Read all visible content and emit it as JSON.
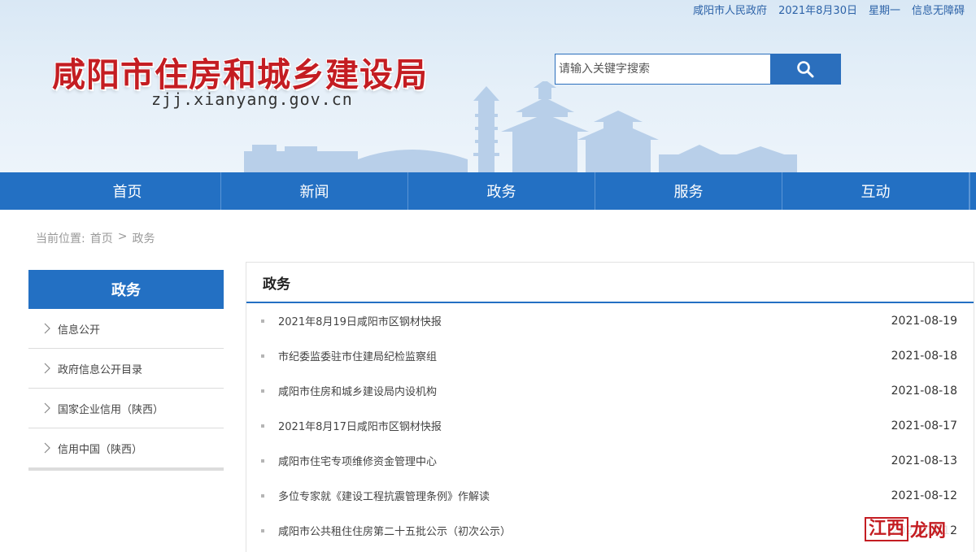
{
  "topbar": {
    "gov_link": "咸阳市人民政府",
    "date": "2021年8月30日",
    "weekday": "星期一",
    "accessibility": "信息无障碍"
  },
  "site": {
    "title": "咸阳市住房和城乡建设局",
    "domain": "zjj.xianyang.gov.cn"
  },
  "search": {
    "placeholder": "请输入关键字搜索",
    "icon": "search-icon"
  },
  "nav": {
    "items": [
      "首页",
      "新闻",
      "政务",
      "服务",
      "互动"
    ]
  },
  "breadcrumb": {
    "prefix": "当前位置:",
    "home": "首页",
    "separator": ">",
    "current": "政务"
  },
  "sidebar": {
    "title": "政务",
    "items": [
      "信息公开",
      "政府信息公开目录",
      "国家企业信用（陕西）",
      "信用中国（陕西）"
    ]
  },
  "main": {
    "title": "政务",
    "news": [
      {
        "title": "2021年8月19日咸阳市区钢材快报",
        "date": "2021-08-19"
      },
      {
        "title": "市纪委监委驻市住建局纪检监察组",
        "date": "2021-08-18"
      },
      {
        "title": "咸阳市住房和城乡建设局内设机构",
        "date": "2021-08-18"
      },
      {
        "title": "2021年8月17日咸阳市区钢材快报",
        "date": "2021-08-17"
      },
      {
        "title": "咸阳市住宅专项维修资金管理中心",
        "date": "2021-08-13"
      },
      {
        "title": "多位专家就《建设工程抗震管理条例》作解读",
        "date": "2021-08-12"
      },
      {
        "title": "咸阳市公共租住住房第二十五批公示（初次公示）",
        "date": "2021-08-12"
      }
    ]
  },
  "watermark": {
    "box_text": "江西",
    "rest_text": "龙网"
  },
  "colors": {
    "brand_blue": "#2370c3",
    "title_red": "#c41d22"
  }
}
